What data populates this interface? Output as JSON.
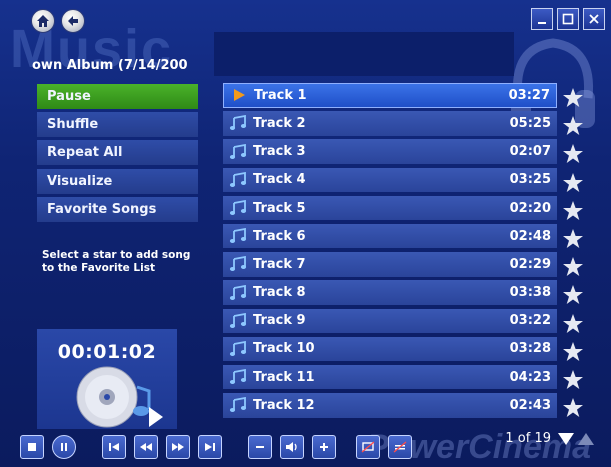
{
  "watermark": "Music",
  "brand_watermark": "PowerCinema",
  "album": {
    "title": "own Album (7/14/200"
  },
  "menu": [
    {
      "label": "Pause",
      "active": true
    },
    {
      "label": "Shuffle",
      "active": false
    },
    {
      "label": "Repeat All",
      "active": false
    },
    {
      "label": "Visualize",
      "active": false
    },
    {
      "label": "Favorite Songs",
      "active": false
    }
  ],
  "hint": "Select a star to add song to the Favorite List",
  "now_playing": {
    "time": "00:01:02"
  },
  "tracks": [
    {
      "name": "Track 1",
      "duration": "03:27",
      "playing": true
    },
    {
      "name": "Track 2",
      "duration": "05:25",
      "playing": false
    },
    {
      "name": "Track 3",
      "duration": "02:07",
      "playing": false
    },
    {
      "name": "Track 4",
      "duration": "03:25",
      "playing": false
    },
    {
      "name": "Track 5",
      "duration": "02:20",
      "playing": false
    },
    {
      "name": "Track 6",
      "duration": "02:48",
      "playing": false
    },
    {
      "name": "Track 7",
      "duration": "02:29",
      "playing": false
    },
    {
      "name": "Track 8",
      "duration": "03:38",
      "playing": false
    },
    {
      "name": "Track 9",
      "duration": "03:22",
      "playing": false
    },
    {
      "name": "Track 10",
      "duration": "03:28",
      "playing": false
    },
    {
      "name": "Track 11",
      "duration": "04:23",
      "playing": false
    },
    {
      "name": "Track 12",
      "duration": "02:43",
      "playing": false
    }
  ],
  "pager": {
    "text": "1 of 19"
  },
  "colors": {
    "active_menu": "#3f9f22",
    "track_bg": "#3050a8",
    "track_active": "#2f63dc",
    "play_icon": "#f29a1c",
    "note_icon": "#8ec8ff"
  }
}
